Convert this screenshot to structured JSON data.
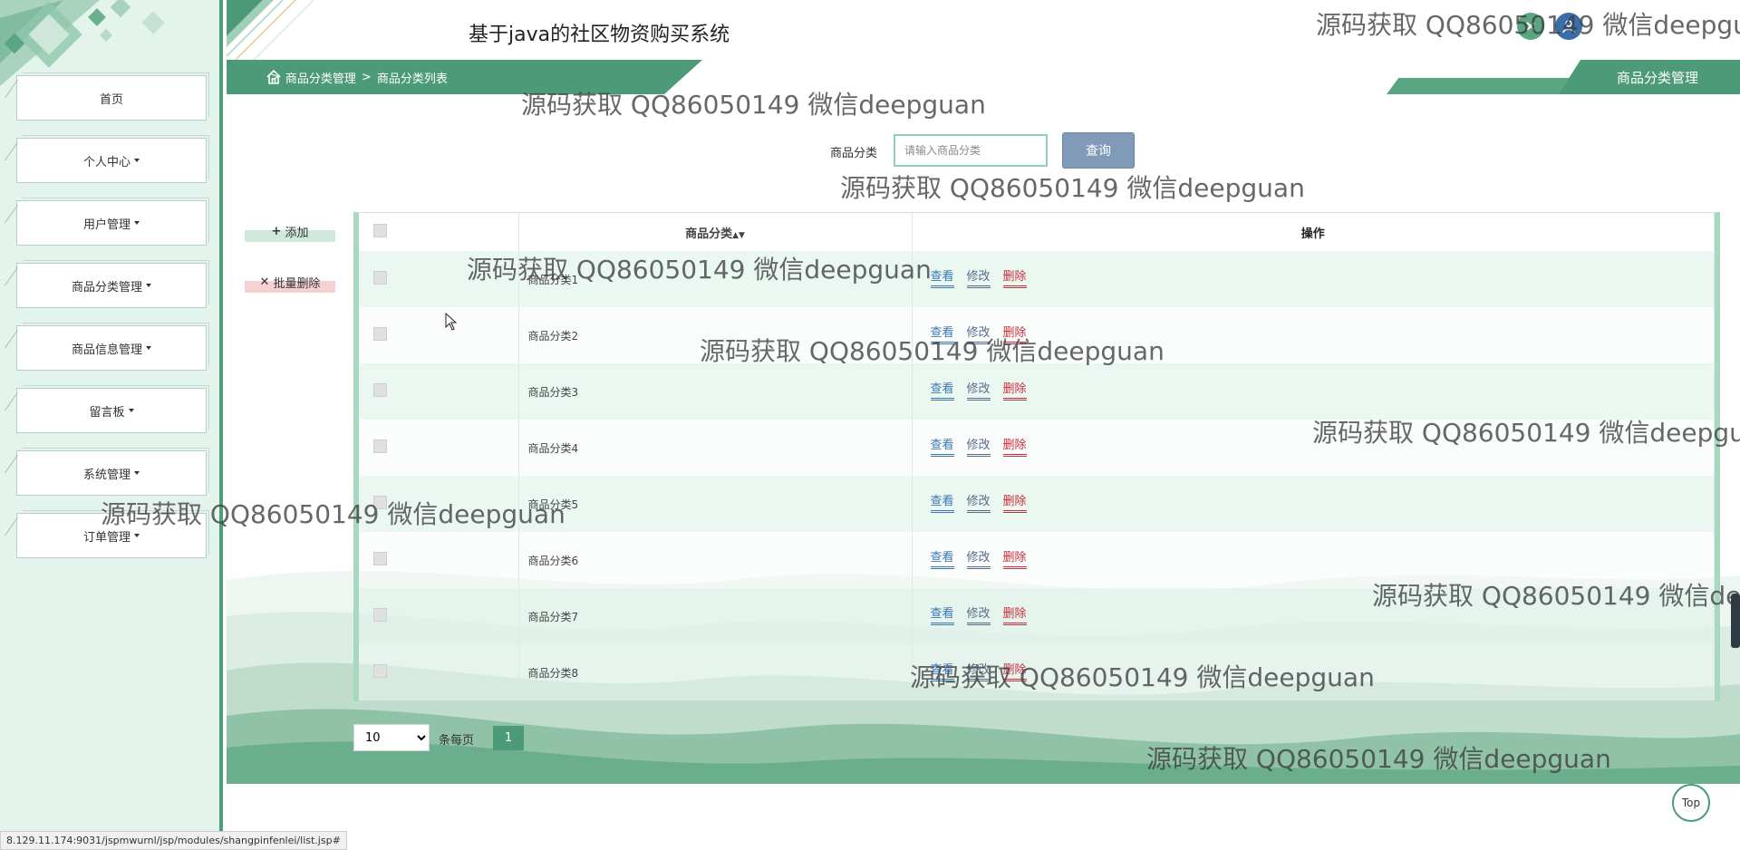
{
  "app": {
    "title": "基于java的社区物资购买系统"
  },
  "colors": {
    "accent": "#4c9a78",
    "sidebar_bg": "#e3f4ec",
    "link_view": "#3b76b1",
    "link_edit": "#566a8a",
    "link_delete": "#c9303d",
    "search_button": "#7f9bb7"
  },
  "header": {
    "icons": [
      "close-icon",
      "user-icon"
    ]
  },
  "sidebar": {
    "items": [
      {
        "label": "首页",
        "dropdown": false
      },
      {
        "label": "个人中心",
        "dropdown": true
      },
      {
        "label": "用户管理",
        "dropdown": true
      },
      {
        "label": "商品分类管理",
        "dropdown": true
      },
      {
        "label": "商品信息管理",
        "dropdown": true
      },
      {
        "label": "留言板",
        "dropdown": true
      },
      {
        "label": "系统管理",
        "dropdown": true
      },
      {
        "label": "订单管理",
        "dropdown": true
      }
    ]
  },
  "breadcrumb": {
    "sep": ">",
    "items": [
      "商品分类管理",
      "商品分类列表"
    ]
  },
  "page_tab": "商品分类管理",
  "search": {
    "label": "商品分类",
    "placeholder": "请输入商品分类",
    "value": "",
    "button": "查询"
  },
  "actions": {
    "add": "添加",
    "batch_delete": "批量删除"
  },
  "table": {
    "columns": [
      "商品分类",
      "操作"
    ],
    "sort_icon": "sort-icon",
    "row_actions": [
      "查看",
      "修改",
      "删除"
    ],
    "rows": [
      "商品分类1",
      "商品分类2",
      "商品分类3",
      "商品分类4",
      "商品分类5",
      "商品分类6",
      "商品分类7",
      "商品分类8"
    ]
  },
  "pagination": {
    "page_size": "10",
    "per_page_label": "条每页",
    "current_page": "1"
  },
  "top_button": "Top",
  "status_url": "8.129.11.174:9031/jspmwurnl/jsp/modules/shangpinfenlei/list.jsp#",
  "watermark": "源码获取 QQ86050149 微信deepguan"
}
